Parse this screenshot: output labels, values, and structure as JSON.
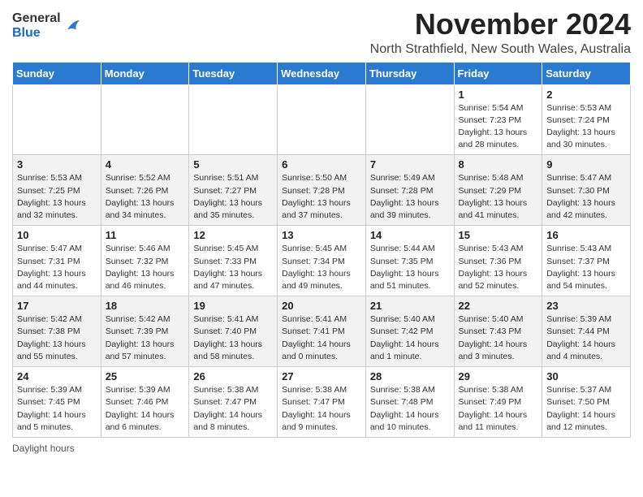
{
  "logo": {
    "general": "General",
    "blue": "Blue"
  },
  "title": "November 2024",
  "subtitle": "North Strathfield, New South Wales, Australia",
  "weekdays": [
    "Sunday",
    "Monday",
    "Tuesday",
    "Wednesday",
    "Thursday",
    "Friday",
    "Saturday"
  ],
  "weeks": [
    [
      {
        "day": "",
        "sunrise": "",
        "sunset": "",
        "daylight": ""
      },
      {
        "day": "",
        "sunrise": "",
        "sunset": "",
        "daylight": ""
      },
      {
        "day": "",
        "sunrise": "",
        "sunset": "",
        "daylight": ""
      },
      {
        "day": "",
        "sunrise": "",
        "sunset": "",
        "daylight": ""
      },
      {
        "day": "",
        "sunrise": "",
        "sunset": "",
        "daylight": ""
      },
      {
        "day": "1",
        "sunrise": "Sunrise: 5:54 AM",
        "sunset": "Sunset: 7:23 PM",
        "daylight": "Daylight: 13 hours and 28 minutes."
      },
      {
        "day": "2",
        "sunrise": "Sunrise: 5:53 AM",
        "sunset": "Sunset: 7:24 PM",
        "daylight": "Daylight: 13 hours and 30 minutes."
      }
    ],
    [
      {
        "day": "3",
        "sunrise": "Sunrise: 5:53 AM",
        "sunset": "Sunset: 7:25 PM",
        "daylight": "Daylight: 13 hours and 32 minutes."
      },
      {
        "day": "4",
        "sunrise": "Sunrise: 5:52 AM",
        "sunset": "Sunset: 7:26 PM",
        "daylight": "Daylight: 13 hours and 34 minutes."
      },
      {
        "day": "5",
        "sunrise": "Sunrise: 5:51 AM",
        "sunset": "Sunset: 7:27 PM",
        "daylight": "Daylight: 13 hours and 35 minutes."
      },
      {
        "day": "6",
        "sunrise": "Sunrise: 5:50 AM",
        "sunset": "Sunset: 7:28 PM",
        "daylight": "Daylight: 13 hours and 37 minutes."
      },
      {
        "day": "7",
        "sunrise": "Sunrise: 5:49 AM",
        "sunset": "Sunset: 7:28 PM",
        "daylight": "Daylight: 13 hours and 39 minutes."
      },
      {
        "day": "8",
        "sunrise": "Sunrise: 5:48 AM",
        "sunset": "Sunset: 7:29 PM",
        "daylight": "Daylight: 13 hours and 41 minutes."
      },
      {
        "day": "9",
        "sunrise": "Sunrise: 5:47 AM",
        "sunset": "Sunset: 7:30 PM",
        "daylight": "Daylight: 13 hours and 42 minutes."
      }
    ],
    [
      {
        "day": "10",
        "sunrise": "Sunrise: 5:47 AM",
        "sunset": "Sunset: 7:31 PM",
        "daylight": "Daylight: 13 hours and 44 minutes."
      },
      {
        "day": "11",
        "sunrise": "Sunrise: 5:46 AM",
        "sunset": "Sunset: 7:32 PM",
        "daylight": "Daylight: 13 hours and 46 minutes."
      },
      {
        "day": "12",
        "sunrise": "Sunrise: 5:45 AM",
        "sunset": "Sunset: 7:33 PM",
        "daylight": "Daylight: 13 hours and 47 minutes."
      },
      {
        "day": "13",
        "sunrise": "Sunrise: 5:45 AM",
        "sunset": "Sunset: 7:34 PM",
        "daylight": "Daylight: 13 hours and 49 minutes."
      },
      {
        "day": "14",
        "sunrise": "Sunrise: 5:44 AM",
        "sunset": "Sunset: 7:35 PM",
        "daylight": "Daylight: 13 hours and 51 minutes."
      },
      {
        "day": "15",
        "sunrise": "Sunrise: 5:43 AM",
        "sunset": "Sunset: 7:36 PM",
        "daylight": "Daylight: 13 hours and 52 minutes."
      },
      {
        "day": "16",
        "sunrise": "Sunrise: 5:43 AM",
        "sunset": "Sunset: 7:37 PM",
        "daylight": "Daylight: 13 hours and 54 minutes."
      }
    ],
    [
      {
        "day": "17",
        "sunrise": "Sunrise: 5:42 AM",
        "sunset": "Sunset: 7:38 PM",
        "daylight": "Daylight: 13 hours and 55 minutes."
      },
      {
        "day": "18",
        "sunrise": "Sunrise: 5:42 AM",
        "sunset": "Sunset: 7:39 PM",
        "daylight": "Daylight: 13 hours and 57 minutes."
      },
      {
        "day": "19",
        "sunrise": "Sunrise: 5:41 AM",
        "sunset": "Sunset: 7:40 PM",
        "daylight": "Daylight: 13 hours and 58 minutes."
      },
      {
        "day": "20",
        "sunrise": "Sunrise: 5:41 AM",
        "sunset": "Sunset: 7:41 PM",
        "daylight": "Daylight: 14 hours and 0 minutes."
      },
      {
        "day": "21",
        "sunrise": "Sunrise: 5:40 AM",
        "sunset": "Sunset: 7:42 PM",
        "daylight": "Daylight: 14 hours and 1 minute."
      },
      {
        "day": "22",
        "sunrise": "Sunrise: 5:40 AM",
        "sunset": "Sunset: 7:43 PM",
        "daylight": "Daylight: 14 hours and 3 minutes."
      },
      {
        "day": "23",
        "sunrise": "Sunrise: 5:39 AM",
        "sunset": "Sunset: 7:44 PM",
        "daylight": "Daylight: 14 hours and 4 minutes."
      }
    ],
    [
      {
        "day": "24",
        "sunrise": "Sunrise: 5:39 AM",
        "sunset": "Sunset: 7:45 PM",
        "daylight": "Daylight: 14 hours and 5 minutes."
      },
      {
        "day": "25",
        "sunrise": "Sunrise: 5:39 AM",
        "sunset": "Sunset: 7:46 PM",
        "daylight": "Daylight: 14 hours and 6 minutes."
      },
      {
        "day": "26",
        "sunrise": "Sunrise: 5:38 AM",
        "sunset": "Sunset: 7:47 PM",
        "daylight": "Daylight: 14 hours and 8 minutes."
      },
      {
        "day": "27",
        "sunrise": "Sunrise: 5:38 AM",
        "sunset": "Sunset: 7:47 PM",
        "daylight": "Daylight: 14 hours and 9 minutes."
      },
      {
        "day": "28",
        "sunrise": "Sunrise: 5:38 AM",
        "sunset": "Sunset: 7:48 PM",
        "daylight": "Daylight: 14 hours and 10 minutes."
      },
      {
        "day": "29",
        "sunrise": "Sunrise: 5:38 AM",
        "sunset": "Sunset: 7:49 PM",
        "daylight": "Daylight: 14 hours and 11 minutes."
      },
      {
        "day": "30",
        "sunrise": "Sunrise: 5:37 AM",
        "sunset": "Sunset: 7:50 PM",
        "daylight": "Daylight: 14 hours and 12 minutes."
      }
    ]
  ],
  "footer": "Daylight hours"
}
